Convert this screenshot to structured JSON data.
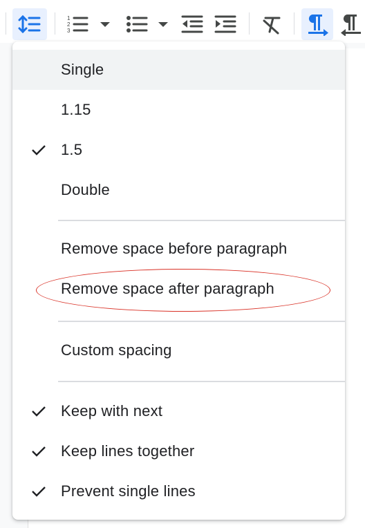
{
  "toolbar": {
    "buttons": [
      {
        "name": "line-spacing-icon",
        "active": true
      },
      {
        "name": "numbered-list-icon"
      },
      {
        "name": "chevron-down-icon"
      },
      {
        "name": "bulleted-list-icon"
      },
      {
        "name": "chevron-down-icon"
      },
      {
        "name": "decrease-indent-icon"
      },
      {
        "name": "increase-indent-icon"
      },
      {
        "name": "clear-formatting-icon"
      },
      {
        "name": "ltr-paragraph-icon",
        "active": true
      },
      {
        "name": "rtl-paragraph-icon"
      }
    ],
    "accent_color": "#1a73e8",
    "active_bg": "#e8f0fe"
  },
  "menu": {
    "spacing_options": [
      {
        "label": "Single",
        "checked": false,
        "hover": true
      },
      {
        "label": "1.15",
        "checked": false
      },
      {
        "label": "1.5",
        "checked": true
      },
      {
        "label": "Double",
        "checked": false
      }
    ],
    "paragraph_space": [
      {
        "label": "Remove space before paragraph"
      },
      {
        "label": "Remove space after paragraph",
        "highlighted": true
      }
    ],
    "custom": {
      "label": "Custom spacing"
    },
    "pagination": [
      {
        "label": "Keep with next",
        "checked": true
      },
      {
        "label": "Keep lines together",
        "checked": true
      },
      {
        "label": "Prevent single lines",
        "checked": true
      }
    ]
  },
  "annotation_color": "#d93025"
}
